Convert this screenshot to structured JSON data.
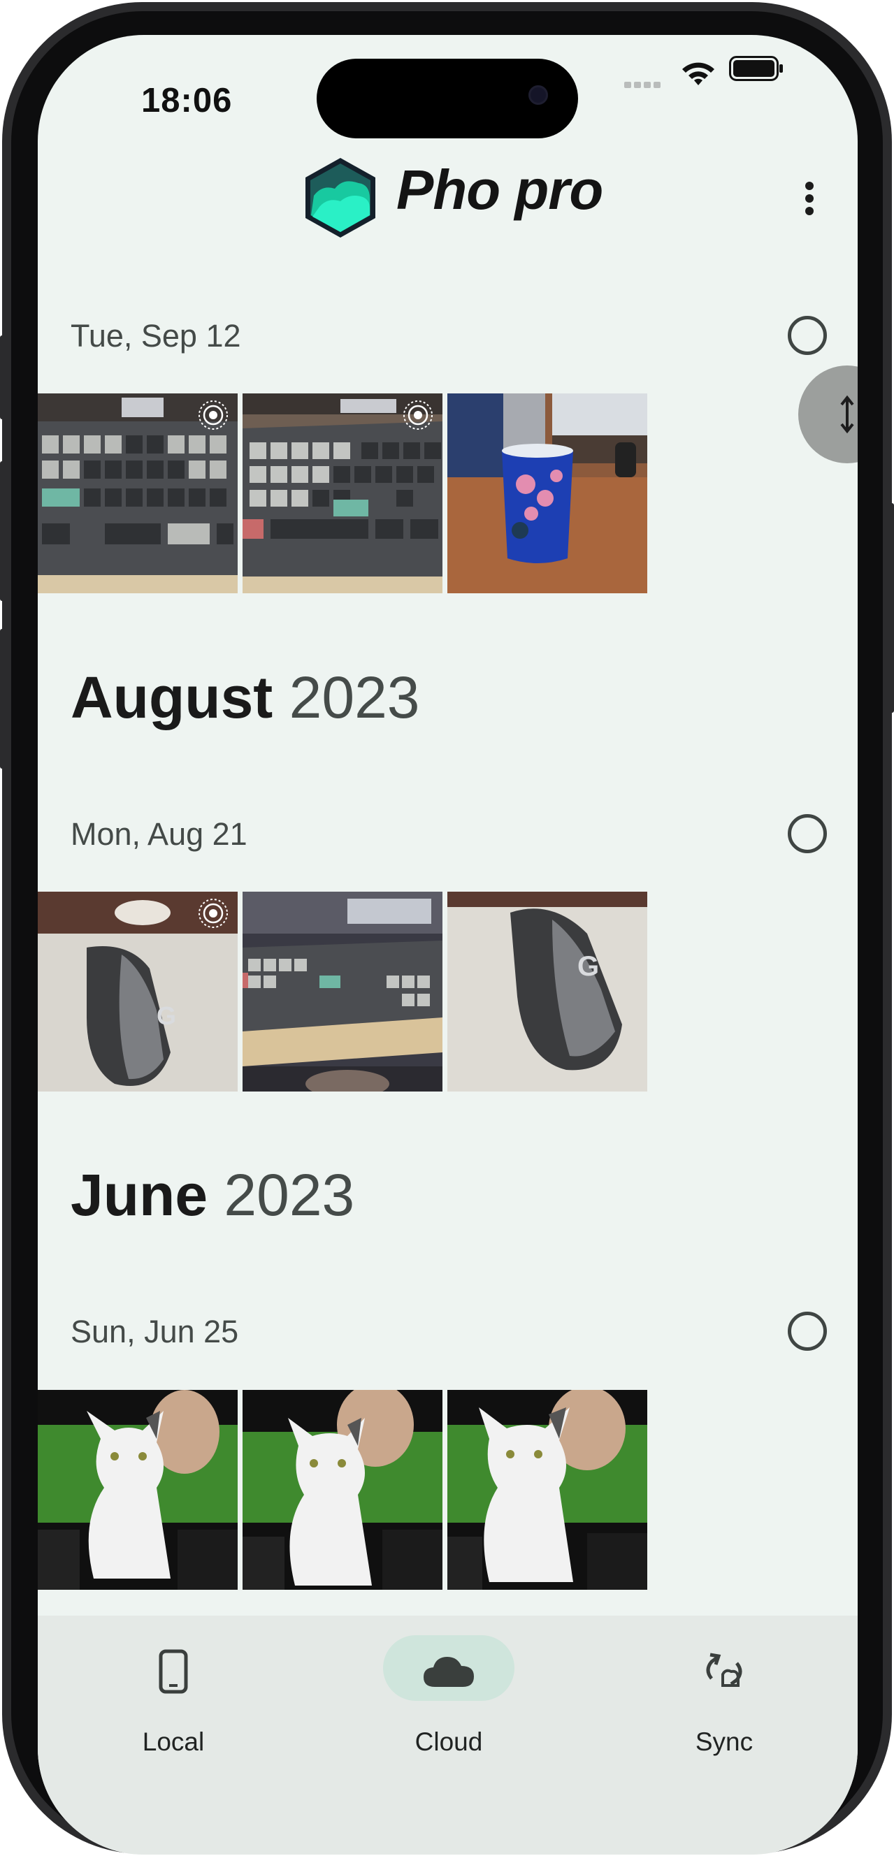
{
  "status_bar": {
    "time": "18:06",
    "icons": [
      "signal-icon",
      "wifi-icon",
      "battery-icon"
    ]
  },
  "app_bar": {
    "title": "Pho pro",
    "logo": "pho-logo-icon",
    "menu_icon": "more-vert-icon"
  },
  "sections": [
    {
      "type": "day",
      "label": "Tue, Sep 12",
      "photos": [
        "keyboard-photo",
        "keyboard-photo",
        "mug-photo"
      ]
    },
    {
      "type": "month",
      "month": "August",
      "year": "2023"
    },
    {
      "type": "day",
      "label": "Mon, Aug 21",
      "photos": [
        "mouse-photo",
        "keyboard-photo",
        "mouse-photo"
      ]
    },
    {
      "type": "month",
      "month": "June",
      "year": "2023"
    },
    {
      "type": "day",
      "label": "Sun, Jun 25",
      "photos": [
        "cat-photo",
        "cat-photo",
        "cat-photo"
      ]
    }
  ],
  "bottom_nav": {
    "items": [
      {
        "label": "Local",
        "icon": "phone-icon"
      },
      {
        "label": "Cloud",
        "icon": "cloud-icon",
        "selected": true
      },
      {
        "label": "Sync",
        "icon": "sync-icon"
      }
    ]
  },
  "colors": {
    "background": "#eef4f1",
    "accent": "#cfe5dc",
    "logo_accent": "#22e0b6"
  }
}
